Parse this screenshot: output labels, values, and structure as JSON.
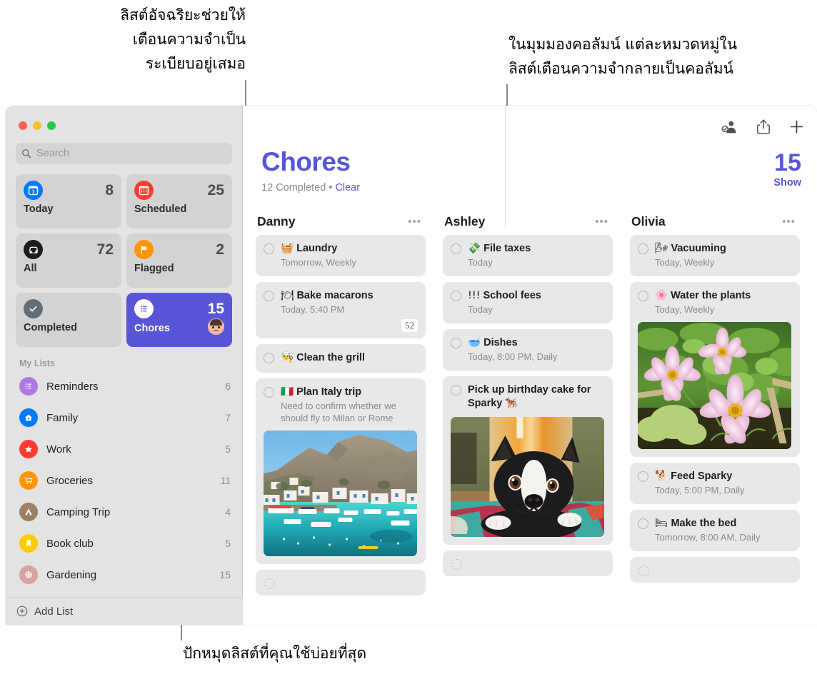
{
  "annotations": {
    "top_left": "ลิสต์อัจฉริยะช่วยให้\nเตือนความจำเป็น\nระเบียบอยู่เสมอ",
    "top_right": "ในมุมมองคอลัมน์ แต่ละหมวดหมู่ใน\nลิสต์เตือนความจำกลายเป็นคอลัมน์",
    "bottom": "ปักหมุดลิสต์ที่คุณใช้บ่อยที่สุด"
  },
  "colors": {
    "accent_purple": "#5856d6",
    "traffic_red": "#ff5f57",
    "traffic_yellow": "#febc2e",
    "traffic_green": "#28c840",
    "sidebar_bg": "#e3e3e3",
    "task_bg": "#e8e8e8"
  },
  "window": {
    "traffic_lights": [
      "close-button",
      "minimize-button",
      "maximize-button"
    ]
  },
  "sidebar": {
    "search": {
      "placeholder": "Search",
      "value": "",
      "icon": "search-icon"
    },
    "smart_lists": [
      {
        "label": "Today",
        "count": "8",
        "icon": "calendar-today-icon",
        "color": "#007aff",
        "selected": false
      },
      {
        "label": "Scheduled",
        "count": "25",
        "icon": "calendar-scheduled-icon",
        "color": "#ff3b30",
        "selected": false
      },
      {
        "label": "All",
        "count": "72",
        "icon": "inbox-tray-icon",
        "color": "#1c1c1e",
        "selected": false
      },
      {
        "label": "Flagged",
        "count": "2",
        "icon": "flag-icon",
        "color": "#ff9500",
        "selected": false
      },
      {
        "label": "Completed",
        "count": "",
        "icon": "checkmark-circle-icon",
        "color": "#5f6e79",
        "selected": false
      },
      {
        "label": "Chores",
        "count": "15",
        "icon": "bullet-list-icon",
        "color": "#ffffff",
        "selected": true,
        "avatar": "user-avatar"
      }
    ],
    "my_lists_header": "My Lists",
    "my_lists": [
      {
        "label": "Reminders",
        "count": "6",
        "icon": "bullet-list-icon",
        "color": "#af7ae0"
      },
      {
        "label": "Family",
        "count": "7",
        "icon": "house-icon",
        "color": "#007aff"
      },
      {
        "label": "Work",
        "count": "5",
        "icon": "star-icon",
        "color": "#ff3b30"
      },
      {
        "label": "Groceries",
        "count": "11",
        "icon": "shopping-cart-icon",
        "color": "#ff9500"
      },
      {
        "label": "Camping Trip",
        "count": "4",
        "icon": "tent-icon",
        "color": "#9c8163"
      },
      {
        "label": "Book club",
        "count": "5",
        "icon": "bookmark-icon",
        "color": "#ffcc00"
      },
      {
        "label": "Gardening",
        "count": "15",
        "icon": "flower-icon",
        "color": "#d8a3a3"
      }
    ],
    "add_list": {
      "label": "Add List",
      "icon": "plus-circle-icon"
    }
  },
  "main": {
    "toolbar": [
      {
        "name": "share-status-button",
        "icon": "person-badge-icon"
      },
      {
        "name": "share-button",
        "icon": "share-arrow-up-icon"
      },
      {
        "name": "add-reminder-button",
        "icon": "plus-icon"
      }
    ],
    "title": "Chores",
    "completed_text": "12 Completed",
    "separator": "•",
    "clear_label": "Clear",
    "total_count": "15",
    "show_label": "Show",
    "columns": [
      {
        "name": "Danny",
        "menu": "•••",
        "tasks": [
          {
            "emoji": "🧺",
            "title": "Laundry",
            "sub": "Tomorrow, Weekly"
          },
          {
            "emoji": "🍽",
            "title": "Bake macarons",
            "sub": "Today, 5:40 PM",
            "badge": "52"
          },
          {
            "emoji": "👨‍🍳",
            "title": "Clean the grill",
            "sub": ""
          },
          {
            "emoji": "🇮🇹",
            "title": "Plan Italy trip",
            "note": "Need to confirm whether we should fly to Milan or Rome",
            "photo": "italy-harbor-photo"
          },
          {
            "empty": true
          }
        ]
      },
      {
        "name": "Ashley",
        "menu": "•••",
        "tasks": [
          {
            "emoji": "💸",
            "title": "File taxes",
            "sub": "Today"
          },
          {
            "emoji": "!!!",
            "title": "School fees",
            "sub": "Today"
          },
          {
            "emoji": "🥣",
            "title": "Dishes",
            "sub": "Today, 8:00 PM, Daily"
          },
          {
            "emoji": "🐕‍🦺",
            "title": "Pick up birthday cake for Sparky",
            "photo": "dog-photo"
          },
          {
            "empty": true
          }
        ]
      },
      {
        "name": "Olivia",
        "menu": "•••",
        "tasks": [
          {
            "emoji": "🌬",
            "title": "Vacuuming",
            "sub": "Today, Weekly"
          },
          {
            "emoji": "🌸",
            "title": "Water the plants",
            "sub": "Today, Weekly",
            "photo": "flowers-photo"
          },
          {
            "emoji": "🐕",
            "title": "Feed Sparky",
            "sub": "Today, 5:00 PM, Daily"
          },
          {
            "emoji": "🛏",
            "title": "Make the bed",
            "sub": "Tomorrow, 8:00 AM, Daily"
          },
          {
            "empty": true
          }
        ]
      }
    ]
  }
}
